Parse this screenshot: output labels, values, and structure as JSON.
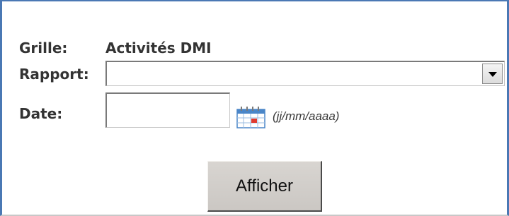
{
  "form": {
    "grid_label": "Grille:",
    "grid_value": "Activités DMI",
    "report_label": "Rapport:",
    "report_selected": "",
    "date_label": "Date:",
    "date_value": "",
    "date_format_hint": "(jj/mm/aaaa)",
    "calendar_icon": "calendar-icon",
    "submit_label": "Afficher"
  },
  "colors": {
    "frame_border": "#4a78b4",
    "label_text": "#333333",
    "button_face": "#d2cfcb",
    "calendar_accent": "#e03a2e",
    "calendar_blue": "#4a86c8"
  }
}
